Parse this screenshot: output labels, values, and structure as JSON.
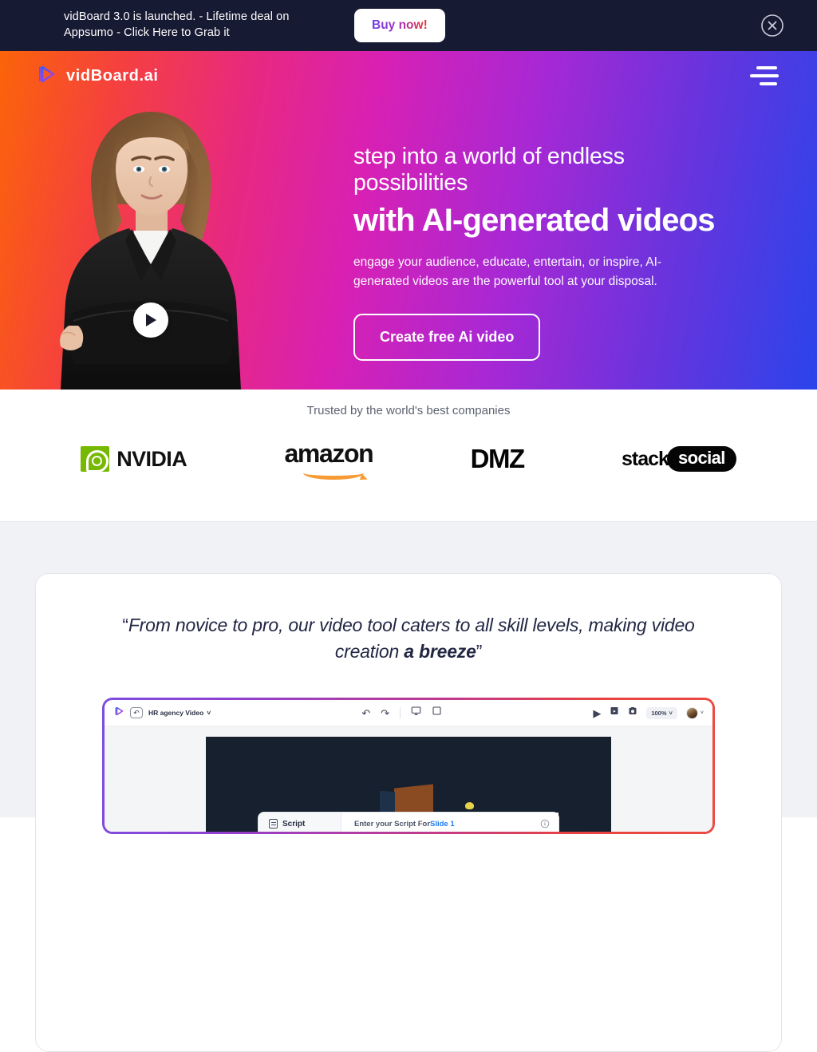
{
  "announcement": {
    "message": "vidBoard 3.0 is launched. - Lifetime deal on Appsumo - Click Here to Grab it",
    "cta_label": "Buy now!",
    "close_icon": "close-circle-icon",
    "background": "#171a33"
  },
  "navbar": {
    "brand": "vidBoard.ai",
    "logo_icon": "vidboard-play-logo-icon",
    "menu_icon": "hamburger-menu-icon"
  },
  "hero": {
    "kicker": "step into a world of endless possibilities",
    "title": "with AI-generated videos",
    "subtitle": "engage your audience, educate, entertain, or inspire, AI-generated videos are the powerful tool at your disposal.",
    "cta_label": "Create free Ai video",
    "play_icon": "play-button-icon",
    "presenter_alt": "AI presenter woman in black blazer",
    "gradient_from": "#fb6409",
    "gradient_mid": "#d820b4",
    "gradient_to": "#2a44ea"
  },
  "trusted": {
    "label": "Trusted by the world's best companies",
    "logos": [
      {
        "name": "NVIDIA",
        "icon": "nvidia-logo-icon",
        "color": "#76b900"
      },
      {
        "name": "amazon",
        "icon": "amazon-logo-icon",
        "color": "#f79b34"
      },
      {
        "name": "DMZ",
        "icon": "dmz-logo-icon",
        "color": "#050505"
      },
      {
        "name": "stack",
        "name2": "social",
        "icon": "stacksocial-logo-icon",
        "color": "#050505"
      }
    ]
  },
  "testimonial": {
    "open_quote": "“",
    "close_quote": "”",
    "text_part1": "From novice to pro, our video tool caters to all skill levels, making video creation ",
    "text_highlight": "a breeze"
  },
  "mockup": {
    "toolbar": {
      "logo_icon": "vidboard-play-logo-icon",
      "back_icon": "undo-back-icon",
      "project_title": "HR agency Video",
      "project_caret": "˅",
      "undo_icon": "↶",
      "redo_icon": "↷",
      "preview_icon": "monitor-icon",
      "frame_icon": "square-frame-icon",
      "play_icon": "▶",
      "export_icon": "export-video-icon",
      "save_icon": "save-icon",
      "zoom_level": "100%",
      "zoom_caret": "˅",
      "avatar_icon": "user-avatar",
      "avatar_caret": "˅"
    },
    "script": {
      "label": "Script",
      "doc_icon": "script-document-icon",
      "placeholder_prefix": "Enter your Script For ",
      "placeholder_slide": "Slide 1",
      "info_icon": "info-icon"
    },
    "border_from": "#7c4de0",
    "border_to": "#ec4b44"
  }
}
